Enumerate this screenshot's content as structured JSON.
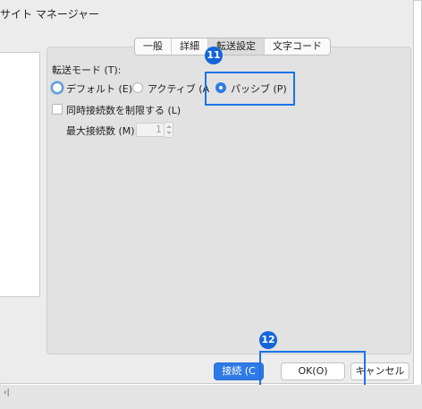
{
  "window": {
    "title": "サイト マネージャー"
  },
  "tabs": [
    {
      "label": "一般",
      "active": false
    },
    {
      "label": "詳細",
      "active": false
    },
    {
      "label": "転送設定",
      "active": true
    },
    {
      "label": "文字コード",
      "active": false
    }
  ],
  "transfer": {
    "mode_label": "転送モード (T):",
    "options": [
      {
        "label": "デフォルト (E)",
        "state": "focused"
      },
      {
        "label": "アクティブ (A",
        "state": "unselected"
      },
      {
        "label": "パッシブ (P)",
        "state": "selected"
      }
    ],
    "limit_label": "同時接続数を制限する (L)",
    "limit_checked": false,
    "max_label": "最大接続数 (M):",
    "max_value": "1"
  },
  "buttons": {
    "connect": "接続 (C",
    "ok": "OK(O)",
    "cancel": "キャンセル"
  },
  "annotations": {
    "step11": "11",
    "step12": "12"
  },
  "colors": {
    "accent": "#2f7ae5",
    "highlight": "#1a73e8",
    "badge": "#1565d8"
  },
  "bottom_strip": {
    "mark": "‹|"
  }
}
